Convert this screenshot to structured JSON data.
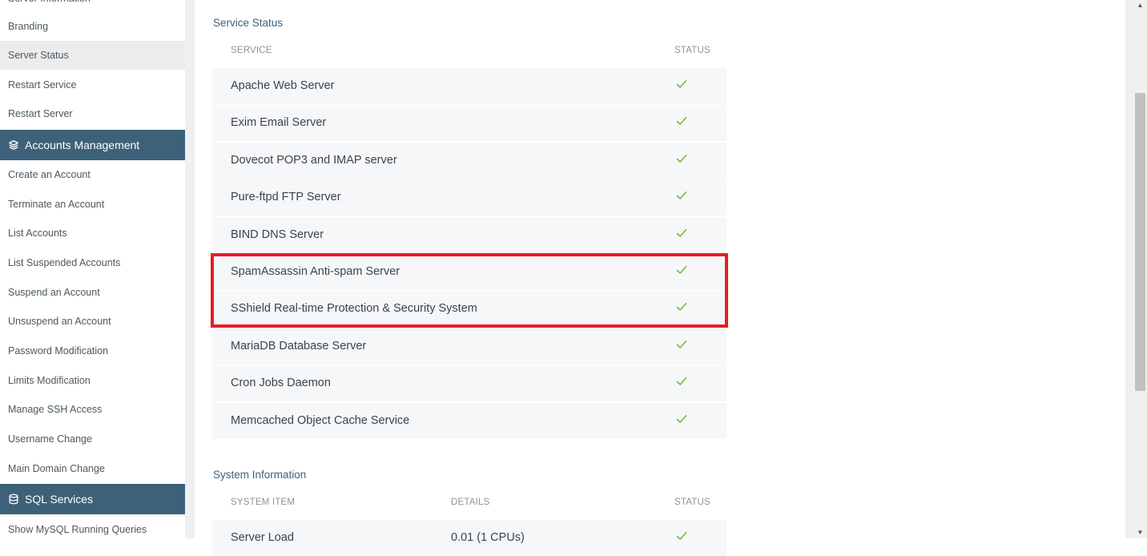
{
  "sidebar": {
    "top_items": [
      {
        "label": "Server Information"
      },
      {
        "label": "Branding"
      },
      {
        "label": "Server Status",
        "active": true
      },
      {
        "label": "Restart Service"
      },
      {
        "label": "Restart Server"
      }
    ],
    "accounts_header": {
      "label": "Accounts Management",
      "icon": "layers-icon"
    },
    "accounts_items": [
      {
        "label": "Create an Account"
      },
      {
        "label": "Terminate an Account"
      },
      {
        "label": "List Accounts"
      },
      {
        "label": "List Suspended Accounts"
      },
      {
        "label": "Suspend an Account"
      },
      {
        "label": "Unsuspend an Account"
      },
      {
        "label": "Password Modification"
      },
      {
        "label": "Limits Modification"
      },
      {
        "label": "Manage SSH Access"
      },
      {
        "label": "Username Change"
      },
      {
        "label": "Main Domain Change"
      }
    ],
    "sql_header": {
      "label": "SQL Services",
      "icon": "database-icon"
    },
    "sql_items": [
      {
        "label": "Show MySQL Running Queries"
      }
    ]
  },
  "service_status": {
    "title": "Service Status",
    "columns": {
      "service": "SERVICE",
      "status": "STATUS"
    },
    "rows": [
      {
        "name": "Apache Web Server",
        "status": "ok"
      },
      {
        "name": "Exim Email Server",
        "status": "ok"
      },
      {
        "name": "Dovecot POP3 and IMAP server",
        "status": "ok"
      },
      {
        "name": "Pure-ftpd FTP Server",
        "status": "ok"
      },
      {
        "name": "BIND DNS Server",
        "status": "ok"
      },
      {
        "name": "SpamAssassin Anti-spam Server",
        "status": "ok",
        "highlighted": true
      },
      {
        "name": "SShield Real-time Protection & Security System",
        "status": "ok",
        "highlighted": true
      },
      {
        "name": "MariaDB Database Server",
        "status": "ok"
      },
      {
        "name": "Cron Jobs Daemon",
        "status": "ok"
      },
      {
        "name": "Memcached Object Cache Service",
        "status": "ok"
      }
    ]
  },
  "system_information": {
    "title": "System Information",
    "columns": {
      "item": "SYSTEM ITEM",
      "details": "DETAILS",
      "status": "STATUS"
    },
    "rows": [
      {
        "name": "Server Load",
        "details": "0.01 (1 CPUs)",
        "status": "ok"
      }
    ]
  },
  "colors": {
    "sidebar_header_bg": "#3d6179",
    "check_green": "#6cbf3c",
    "highlight_red": "#e41e26",
    "section_title": "#3d6179"
  }
}
